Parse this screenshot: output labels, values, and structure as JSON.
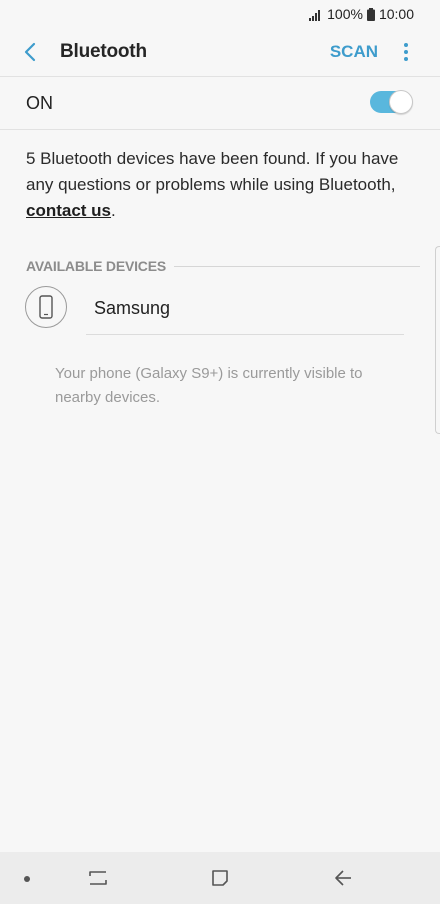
{
  "status_bar": {
    "battery": "100%",
    "time": "10:00",
    "icons": [
      "signal-icon",
      "battery-icon"
    ]
  },
  "header": {
    "title": "Bluetooth",
    "scan_label": "SCAN",
    "icons": [
      "back-arrow-icon",
      "more-options-icon"
    ],
    "accent_color": "#3e9ccc"
  },
  "toggle": {
    "label": "ON",
    "state": "on",
    "color": "#59b7dd"
  },
  "info": {
    "text_before": "5 Bluetooth devices have been found. If you have any questions or problems while using Bluetooth, ",
    "link_text": "contact us",
    "text_after": "."
  },
  "available_devices": {
    "section_title": "AVAILABLE DEVICES",
    "items": [
      {
        "name": "Samsung",
        "icon": "phone-icon"
      }
    ]
  },
  "visibility_note": "Your phone (Galaxy S9+) is currently visible to nearby devices.",
  "nav_bar": {
    "icons": [
      "nav-dot-icon",
      "recents-icon",
      "home-icon",
      "back-icon"
    ]
  }
}
